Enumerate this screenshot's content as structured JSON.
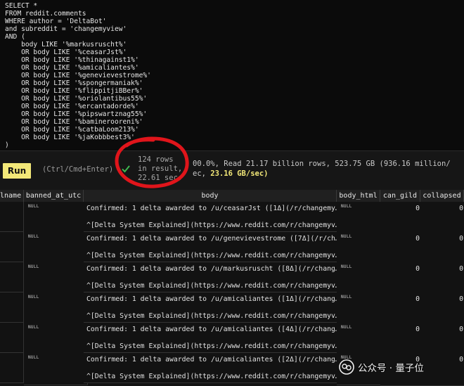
{
  "query": {
    "lines": [
      "SELECT *",
      "FROM reddit.comments",
      "WHERE author = 'DeltaBot'",
      "and subreddit = 'changemyview'",
      "AND (",
      "    body LIKE '%markusruscht%'",
      "    OR body LIKE '%ceasarJst%'",
      "    OR body LIKE '%thinagainst1%'",
      "    OR body LIKE '%amicaliantes%'",
      "    OR body LIKE '%genevievestrome%'",
      "    OR body LIKE '%spongermaniak%'",
      "    OR body LIKE '%flippitjiBBer%'",
      "    OR body LIKE '%oriolantibus55%'",
      "    OR body LIKE '%ercantadorde%'",
      "    OR body LIKE '%pipswartznag55%'",
      "    OR body LIKE '%baminerooreni%'",
      "    OR body LIKE '%catbaLoom213%'",
      "    OR body LIKE '%jaKobbbest3%'",
      ")"
    ]
  },
  "runbar": {
    "run_label": "Run",
    "shortcut_hint": "(Ctrl/Cmd+Enter)",
    "result_lines": [
      "124 rows",
      "in result,",
      "22.61 sec."
    ],
    "stats_line1": "00.0%, Read 21.17 billion rows, 523.75 GB (936.16 million/",
    "stats_line2_prefix": "ec, ",
    "stats_speed": "23.16 GB/sec)"
  },
  "table": {
    "columns": [
      "lname",
      "banned_at_utc",
      "body",
      "body_html",
      "can_gild",
      "collapsed"
    ],
    "rows": [
      {
        "banned_at_utc": "NULL",
        "body_line1": "Confirmed: 1 delta awarded to /u/ceasarJst ([1Δ](/r/changemy…",
        "body_line2": "^[Delta System Explained](https://www.reddit.com/r/changemyv…",
        "body_html": "NULL",
        "can_gild": "0",
        "collapsed": "0"
      },
      {
        "banned_at_utc": "NULL",
        "body_line1": "Confirmed: 1 delta awarded to /u/genevievestrome ([7Δ](/r/ch…",
        "body_line2": "^[Delta System Explained](https://www.reddit.com/r/changemyv…",
        "body_html": "NULL",
        "can_gild": "0",
        "collapsed": "0"
      },
      {
        "banned_at_utc": "NULL",
        "body_line1": "Confirmed: 1 delta awarded to /u/markusruscht ([8Δ](/r/chang…",
        "body_line2": "^[Delta System Explained](https://www.reddit.com/r/changemyv…",
        "body_html": "NULL",
        "can_gild": "0",
        "collapsed": "0"
      },
      {
        "banned_at_utc": "NULL",
        "body_line1": "Confirmed: 1 delta awarded to /u/amicaliantes ([1Δ](/r/chang…",
        "body_line2": "^[Delta System Explained](https://www.reddit.com/r/changemyv…",
        "body_html": "NULL",
        "can_gild": "0",
        "collapsed": "0"
      },
      {
        "banned_at_utc": "NULL",
        "body_line1": "Confirmed: 1 delta awarded to /u/amicaliantes ([4Δ](/r/chang…",
        "body_line2": "^[Delta System Explained](https://www.reddit.com/r/changemyv…",
        "body_html": "NULL",
        "can_gild": "0",
        "collapsed": "0"
      },
      {
        "banned_at_utc": "NULL",
        "body_line1": "Confirmed: 1 delta awarded to /u/amicaliantes ([2Δ](/r/chang…",
        "body_line2": "^[Delta System Explained](https://www.reddit.com/r/changemyv…",
        "body_html": "NULL",
        "can_gild": "0",
        "collapsed": "0"
      }
    ]
  },
  "watermark": {
    "text": "公众号 · 量子位",
    "icon": "wechat-official-account-icon"
  },
  "colors": {
    "run_button": "#f3e878",
    "annotation_ring": "#e0151b",
    "check": "#3fb950"
  }
}
